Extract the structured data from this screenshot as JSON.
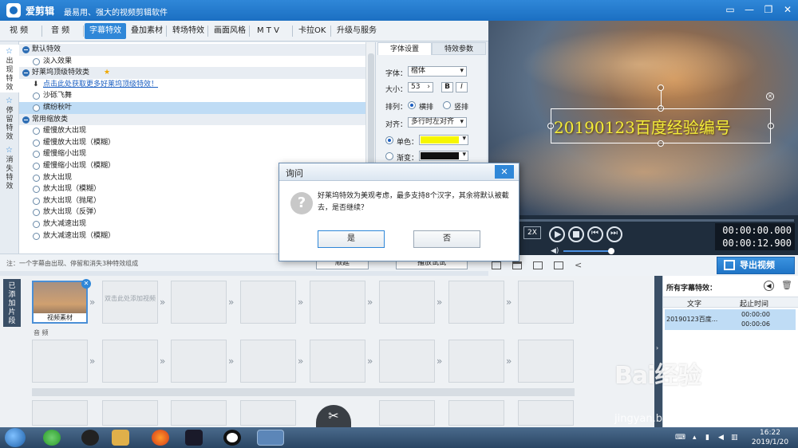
{
  "window": {
    "app_name": "爱剪辑",
    "slogan": "最易用、强大的视频剪辑软件"
  },
  "menu": {
    "tabs": [
      {
        "label": "视 频"
      },
      {
        "label": "音 频"
      },
      {
        "label": "字幕特效"
      },
      {
        "label": "叠加素材"
      },
      {
        "label": "转场特效"
      },
      {
        "label": "画面风格"
      },
      {
        "label": "M T V"
      },
      {
        "label": "卡拉OK"
      },
      {
        "label": "升级与服务"
      }
    ],
    "active_index": 2
  },
  "side_tabs": [
    {
      "label": "出现特效"
    },
    {
      "label": "停留特效"
    },
    {
      "label": "消失特效"
    }
  ],
  "effects": [
    {
      "label": "默认特效",
      "kind": "group"
    },
    {
      "label": "淡入效果",
      "kind": "item"
    },
    {
      "label": "好莱坞顶级特效类",
      "kind": "group"
    },
    {
      "label": "点击此处获取更多好莱坞顶级特效！",
      "kind": "link"
    },
    {
      "label": "沙砾飞舞",
      "kind": "item"
    },
    {
      "label": "缤纷秋叶",
      "kind": "item",
      "selected": true
    },
    {
      "label": "常用缩放类",
      "kind": "group"
    },
    {
      "label": "缓慢放大出现",
      "kind": "item"
    },
    {
      "label": "缓慢放大出现（模糊）",
      "kind": "item"
    },
    {
      "label": "缓慢缩小出现",
      "kind": "item"
    },
    {
      "label": "缓慢缩小出现（模糊）",
      "kind": "item"
    },
    {
      "label": "放大出现",
      "kind": "item"
    },
    {
      "label": "放大出现（模糊）",
      "kind": "item"
    },
    {
      "label": "放大出现（抛尾）",
      "kind": "item"
    },
    {
      "label": "放大出现（反弹）",
      "kind": "item"
    },
    {
      "label": "放大减速出现",
      "kind": "item"
    },
    {
      "label": "放大减速出现（模糊）",
      "kind": "item"
    }
  ],
  "settings": {
    "tab_font": "字体设置",
    "tab_effect": "特效参数",
    "font_label": "字体：",
    "font_value": "楷体",
    "size_label": "大小：",
    "size_value": "53",
    "bold": "B",
    "italic": "I",
    "arrange_label": "排列：",
    "arrange_h": "横排",
    "arrange_v": "竖排",
    "align_label": "对齐：",
    "align_value": "多行时左对齐",
    "solid_label": "单色：",
    "gradient_label": "渐变：",
    "solid_color": "#f6f600"
  },
  "hint": "注：一个字幕由出现、停留和消失3种特效组成",
  "buttons": {
    "below_left": "顺延",
    "below_mid": "播放试试"
  },
  "preview": {
    "overlay_text": "20190123百度经验编号"
  },
  "playback": {
    "speed": "2X",
    "time_current": "00:00:00.000",
    "time_total": "00:00:12.900"
  },
  "export": {
    "label": "导出视频"
  },
  "timeline": {
    "added_tab": "已添加片段",
    "media_label": "视频素材",
    "add_hint": "双击此处添加视频",
    "audio_label": "音 频"
  },
  "subtitles": {
    "title": "所有字幕特效：",
    "col_text": "文字",
    "col_time": "起止时间",
    "row_text": "20190123百度...",
    "row_start": "00:00:00",
    "row_end": "00:00:06"
  },
  "dialog": {
    "title": "询问",
    "message": "好莱坞特效为美观考虑，最多支持8个汉字，其余将默认被截去，是否继续？",
    "yes": "是",
    "no": "否"
  },
  "taskbar": {
    "time": "16:22",
    "date": "2019/1/20"
  },
  "watermark": {
    "logo": "Bai经验",
    "url": "jingyan.baidu.com"
  }
}
